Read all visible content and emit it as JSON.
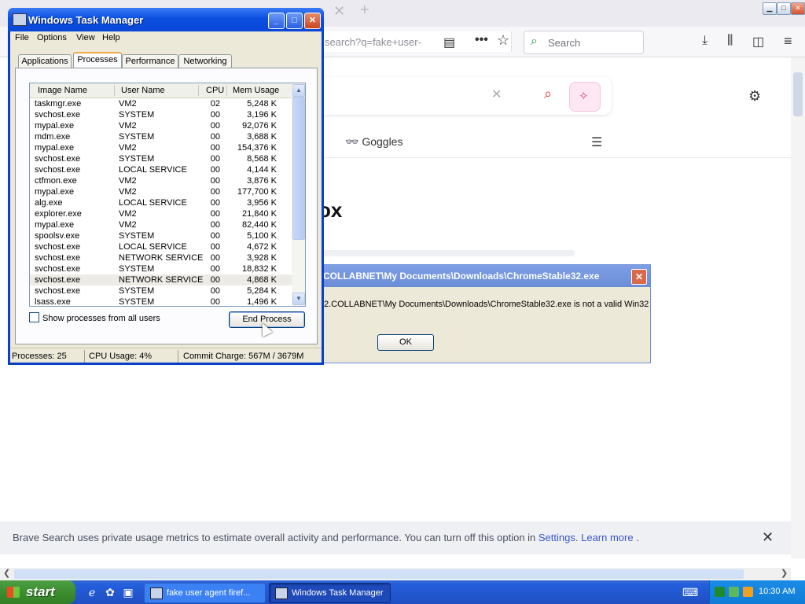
{
  "browser": {
    "url_fragment": "search?q=fake+user-",
    "search_placeholder": "Search",
    "goggles_label": "Goggles",
    "headline_fragment": "ox",
    "banner": {
      "text": "Brave Search uses private usage metrics to estimate overall activity and performance. You can turn off this option in ",
      "settings_link": "Settings",
      "sep": ". ",
      "learn_more_link": "Learn more",
      "tail": " ."
    }
  },
  "error_dialog": {
    "title": "COLLABNET\\My Documents\\Downloads\\ChromeStable32.exe",
    "message": "2.COLLABNET\\My Documents\\Downloads\\ChromeStable32.exe is not a valid Win32",
    "ok_label": "OK"
  },
  "task_manager": {
    "title": "Windows Task Manager",
    "menu": [
      "File",
      "Options",
      "View",
      "Help"
    ],
    "tabs": [
      "Applications",
      "Processes",
      "Performance",
      "Networking"
    ],
    "columns": [
      "Image Name",
      "User Name",
      "CPU",
      "Mem Usage"
    ],
    "processes": [
      {
        "name": "taskmgr.exe",
        "user": "VM2",
        "cpu": "02",
        "mem": "5,248 K"
      },
      {
        "name": "svchost.exe",
        "user": "SYSTEM",
        "cpu": "00",
        "mem": "3,196 K"
      },
      {
        "name": "mypal.exe",
        "user": "VM2",
        "cpu": "00",
        "mem": "92,076 K"
      },
      {
        "name": "mdm.exe",
        "user": "SYSTEM",
        "cpu": "00",
        "mem": "3,688 K"
      },
      {
        "name": "mypal.exe",
        "user": "VM2",
        "cpu": "00",
        "mem": "154,376 K"
      },
      {
        "name": "svchost.exe",
        "user": "SYSTEM",
        "cpu": "00",
        "mem": "8,568 K"
      },
      {
        "name": "svchost.exe",
        "user": "LOCAL SERVICE",
        "cpu": "00",
        "mem": "4,144 K"
      },
      {
        "name": "ctfmon.exe",
        "user": "VM2",
        "cpu": "00",
        "mem": "3,876 K"
      },
      {
        "name": "mypal.exe",
        "user": "VM2",
        "cpu": "00",
        "mem": "177,700 K"
      },
      {
        "name": "alg.exe",
        "user": "LOCAL SERVICE",
        "cpu": "00",
        "mem": "3,956 K"
      },
      {
        "name": "explorer.exe",
        "user": "VM2",
        "cpu": "00",
        "mem": "21,840 K"
      },
      {
        "name": "mypal.exe",
        "user": "VM2",
        "cpu": "00",
        "mem": "82,440 K"
      },
      {
        "name": "spoolsv.exe",
        "user": "SYSTEM",
        "cpu": "00",
        "mem": "5,100 K"
      },
      {
        "name": "svchost.exe",
        "user": "LOCAL SERVICE",
        "cpu": "00",
        "mem": "4,672 K"
      },
      {
        "name": "svchost.exe",
        "user": "NETWORK SERVICE",
        "cpu": "00",
        "mem": "3,928 K"
      },
      {
        "name": "svchost.exe",
        "user": "SYSTEM",
        "cpu": "00",
        "mem": "18,832 K"
      },
      {
        "name": "svchost.exe",
        "user": "NETWORK SERVICE",
        "cpu": "00",
        "mem": "4,868 K"
      },
      {
        "name": "svchost.exe",
        "user": "SYSTEM",
        "cpu": "00",
        "mem": "5,284 K"
      },
      {
        "name": "lsass.exe",
        "user": "SYSTEM",
        "cpu": "00",
        "mem": "1,496 K"
      }
    ],
    "show_all_label": "Show processes from all users",
    "end_process_label": "End Process",
    "status": {
      "processes": "Processes: 25",
      "cpu": "CPU Usage: 4%",
      "commit": "Commit Charge: 567M / 3679M"
    }
  },
  "taskbar": {
    "start_label": "start",
    "buttons": [
      "fake user agent firef...",
      "Windows Task Manager"
    ],
    "clock": "10:30 AM"
  },
  "colors": {
    "xp_title_blue": "#0a47d8",
    "start_green": "#3c8d2e",
    "brave_link": "#3a55c8"
  }
}
